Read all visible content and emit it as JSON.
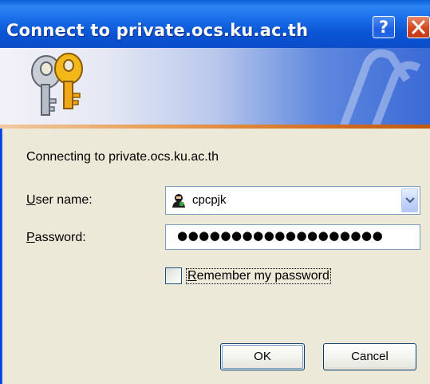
{
  "window": {
    "title": "Connect to private.ocs.ku.ac.th",
    "help_glyph": "?"
  },
  "banner": {
    "icon": "keys-icon"
  },
  "body": {
    "connecting_text": "Connecting to private.ocs.ku.ac.th",
    "username_label_first": "U",
    "username_label_rest": "ser name:",
    "password_label_first": "P",
    "password_label_rest": "assword:",
    "username_value": "cpcpjk",
    "password_mask": "●●●●●●●●●●●●●●●●●●●",
    "remember_label_first": "R",
    "remember_label_rest": "emember my password",
    "remember_checked": false
  },
  "buttons": {
    "ok_label": "OK",
    "cancel_label": "Cancel"
  },
  "colors": {
    "titlebar": "#0A54D3",
    "dialog_bg": "#ECE9D8",
    "close_red": "#D34820",
    "banner_stripe": "#E79A4F"
  }
}
